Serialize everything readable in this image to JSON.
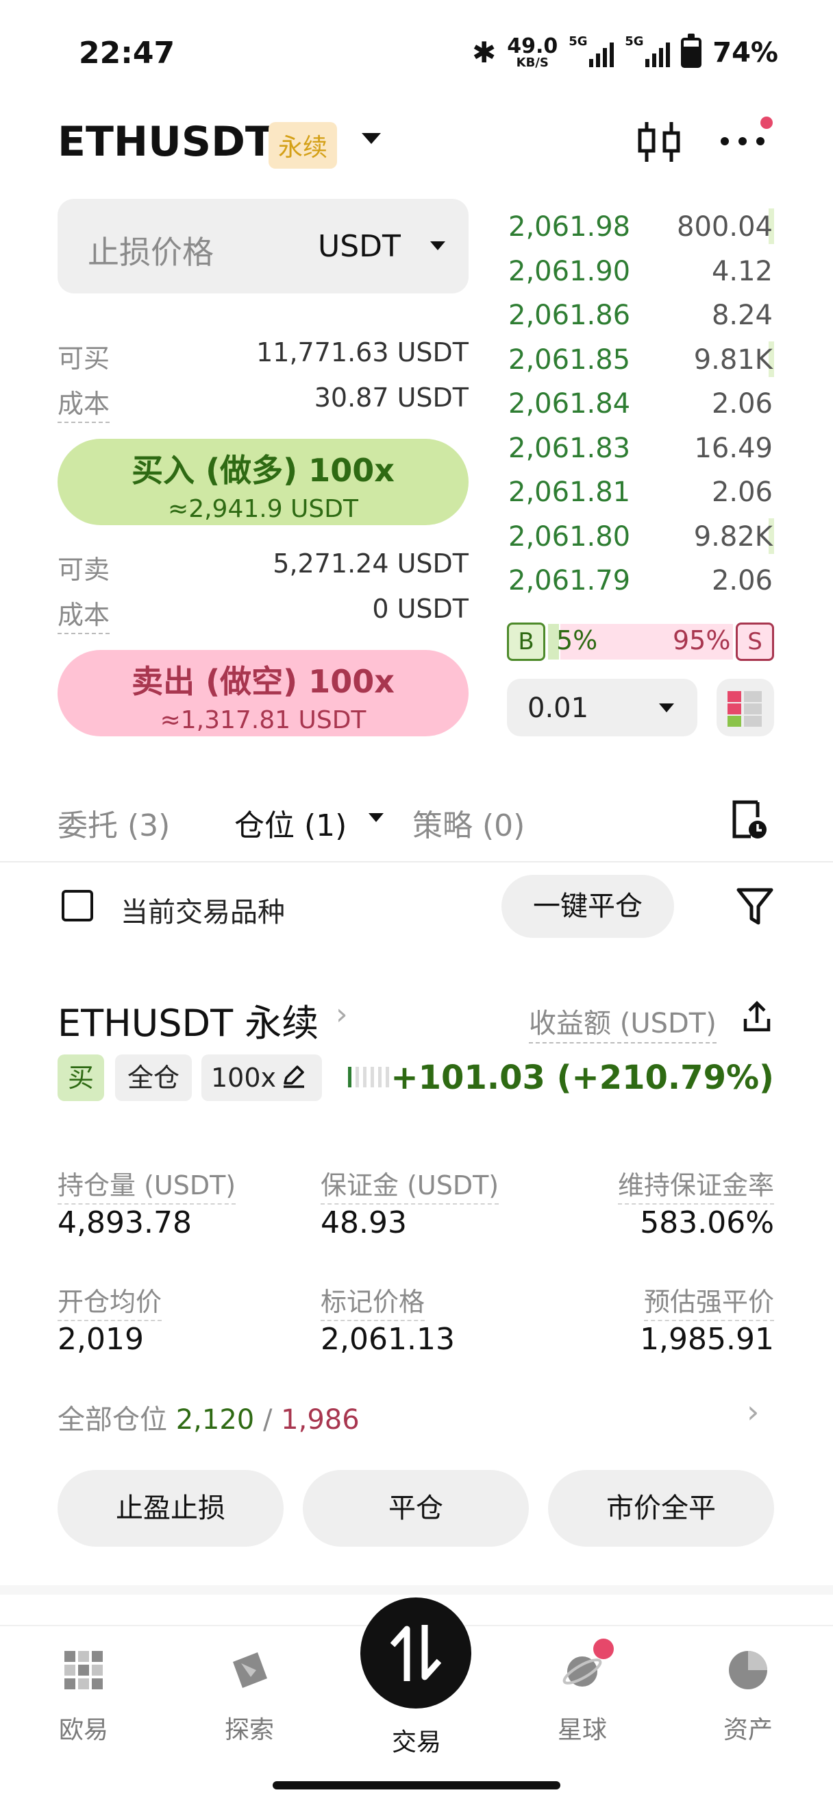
{
  "status_bar": {
    "time": "22:47",
    "net_speed": "49.0",
    "net_speed_unit": "KB/S",
    "sim1": "5G",
    "sim2": "5G",
    "battery": "74%"
  },
  "header": {
    "pair": "ETHUSDT",
    "badge": "永续",
    "icons": [
      "chevron-down-icon",
      "candlestick-icon",
      "more-icon"
    ]
  },
  "order_form": {
    "stop_price_label": "止损价格",
    "unit": "USDT",
    "buy_avail_label": "可买",
    "buy_avail_value": "11,771.63 USDT",
    "buy_cost_label": "成本",
    "buy_cost_value": "30.87 USDT",
    "buy_button": "买入 (做多) 100x",
    "buy_estimate": "≈2,941.9 USDT",
    "sell_avail_label": "可卖",
    "sell_avail_value": "5,271.24 USDT",
    "sell_cost_label": "成本",
    "sell_cost_value": "0 USDT",
    "sell_button": "卖出 (做空) 100x",
    "sell_estimate": "≈1,317.81 USDT"
  },
  "order_book": {
    "rows": [
      {
        "price": "2,061.98",
        "qty": "800.04",
        "depth": 0.02
      },
      {
        "price": "2,061.90",
        "qty": "4.12",
        "depth": 0.0
      },
      {
        "price": "2,061.86",
        "qty": "8.24",
        "depth": 0.0
      },
      {
        "price": "2,061.85",
        "qty": "9.81K",
        "depth": 0.02
      },
      {
        "price": "2,061.84",
        "qty": "2.06",
        "depth": 0.0
      },
      {
        "price": "2,061.83",
        "qty": "16.49",
        "depth": 0.0
      },
      {
        "price": "2,061.81",
        "qty": "2.06",
        "depth": 0.0
      },
      {
        "price": "2,061.80",
        "qty": "9.82K",
        "depth": 0.02
      },
      {
        "price": "2,061.79",
        "qty": "2.06",
        "depth": 0.0
      }
    ],
    "buy_tag": "B",
    "sell_tag": "S",
    "buy_ratio": "5%",
    "sell_ratio": "95%",
    "precision": "0.01",
    "colors": {
      "bid": "#2e7d32",
      "ask": "#a8364f"
    }
  },
  "tabs": [
    {
      "label": "委托 (3)"
    },
    {
      "label": "仓位 (1)"
    },
    {
      "label": "策略 (0)"
    }
  ],
  "filter_bar": {
    "checkbox_label": "当前交易品种",
    "close_all": "一键平仓"
  },
  "position": {
    "title": "ETHUSDT 永续",
    "pnl_label": "收益额 (USDT)",
    "tag_side": "买",
    "tag_margin": "全仓",
    "tag_leverage": "100x",
    "risk_level": 1,
    "pnl_value": "+101.03 (+210.79%)",
    "metrics": {
      "size_label": "持仓量 (USDT)",
      "size_value": "4,893.78",
      "margin_label": "保证金 (USDT)",
      "margin_value": "48.93",
      "mmr_label": "维持保证金率",
      "mmr_value": "583.06%",
      "entry_label": "开仓均价",
      "entry_value": "2,019",
      "mark_label": "标记价格",
      "mark_value": "2,061.13",
      "liq_label": "预估强平价",
      "liq_value": "1,985.91"
    },
    "all_label": "全部仓位",
    "all_long": "2,120",
    "all_sep": "/",
    "all_short": "1,986",
    "actions": {
      "tp_sl": "止盈止损",
      "close": "平仓",
      "market_close": "市价全平"
    }
  },
  "bottom_nav": [
    {
      "label": "欧易",
      "icon": "okx-logo-icon"
    },
    {
      "label": "探索",
      "icon": "compass-icon"
    },
    {
      "label": "交易",
      "icon": "trade-arrows-icon"
    },
    {
      "label": "星球",
      "icon": "planet-icon"
    },
    {
      "label": "资产",
      "icon": "pie-chart-icon"
    }
  ]
}
